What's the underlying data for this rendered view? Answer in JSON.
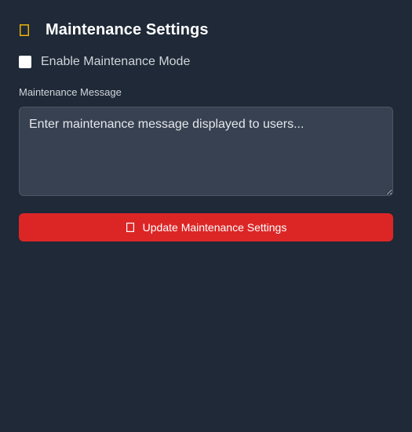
{
  "header": {
    "title": "Maintenance Settings",
    "icon": "tools-icon",
    "icon_color": "#eab308"
  },
  "maintenance_mode": {
    "label": "Enable Maintenance Mode",
    "checked": false
  },
  "message_field": {
    "label": "Maintenance Message",
    "value": "",
    "placeholder": "Enter maintenance message displayed to users..."
  },
  "submit": {
    "label": "Update Maintenance Settings",
    "icon": "save-icon",
    "color": "#dc2626"
  },
  "colors": {
    "background": "#1f2937",
    "input_background": "#374151",
    "text_primary": "#ffffff",
    "text_secondary": "#d1d5db"
  }
}
